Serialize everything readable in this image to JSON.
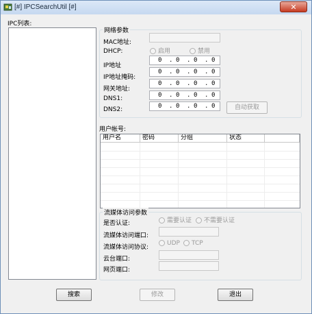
{
  "window": {
    "title": "[#] IPCSearchUtil [#]",
    "close_glyph": "✕"
  },
  "ipc_list": {
    "label": "IPC列表:",
    "items": []
  },
  "network": {
    "group_title": "网络参数",
    "mac_label": "MAC地址:",
    "mac_value": "",
    "dhcp_label": "DHCP:",
    "dhcp_enable": "启用",
    "dhcp_disable": "禁用",
    "ip_label": "IP地址",
    "mask_label": "IP地址掩码:",
    "gateway_label": "网关地址:",
    "dns1_label": "DNS1:",
    "dns2_label": "DNS2:",
    "ip_value": [
      "0",
      "0",
      "0",
      "0"
    ],
    "mask_value": [
      "0",
      "0",
      "0",
      "0"
    ],
    "gateway_value": [
      "0",
      "0",
      "0",
      "0"
    ],
    "dns1_value": [
      "0",
      "0",
      "0",
      "0"
    ],
    "dns2_value": [
      "0",
      "0",
      "0",
      "0"
    ],
    "auto_get_button": "自动获取"
  },
  "users": {
    "label": "用户帐号:",
    "columns": [
      "用户名",
      "密码",
      "分组",
      "状态"
    ],
    "rows": []
  },
  "stream": {
    "group_title": "流媒体访问参数",
    "auth_label": "是否认证:",
    "auth_required": "需要认证",
    "auth_not_required": "不需要认证",
    "port_label": "流媒体访问端口:",
    "protocol_label": "流媒体访问协议:",
    "udp": "UDP",
    "tcp": "TCP",
    "ptz_port_label": "云台端口:",
    "web_port_label": "网页端口:"
  },
  "buttons": {
    "search": "搜索",
    "modify": "修改",
    "exit": "退出"
  },
  "colors": {
    "close_button": "#c73b22",
    "window_bg": "#f0f0f0",
    "titlebar": "#c5d8f0"
  }
}
